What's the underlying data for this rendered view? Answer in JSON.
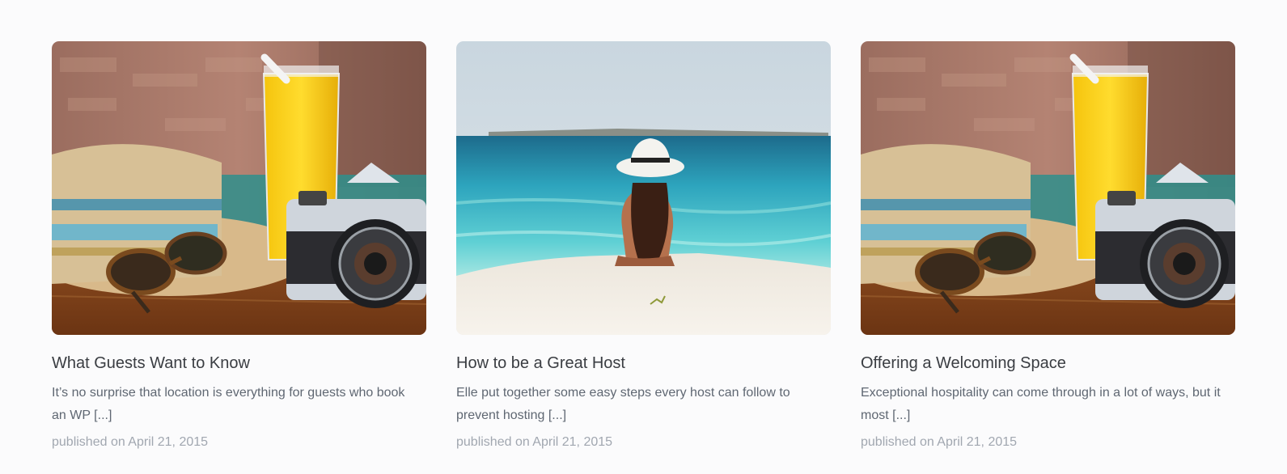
{
  "posts": [
    {
      "title": "What Guests Want to Know",
      "excerpt": "It’s no surprise that location is everything for guests who book an WP [...]",
      "published": "published on April 21, 2015",
      "image": "straw-hat-camera-juice-photo"
    },
    {
      "title": "How to be a Great Host",
      "excerpt": "Elle put together some easy steps every host can follow to prevent hosting [...]",
      "published": "published on April 21, 2015",
      "image": "woman-beach-sea-photo"
    },
    {
      "title": "Offering a Welcoming Space",
      "excerpt": "Exceptional hospitality can come through in a lot of ways, but it most [...]",
      "published": "published on April 21, 2015",
      "image": "straw-hat-camera-juice-photo"
    }
  ]
}
